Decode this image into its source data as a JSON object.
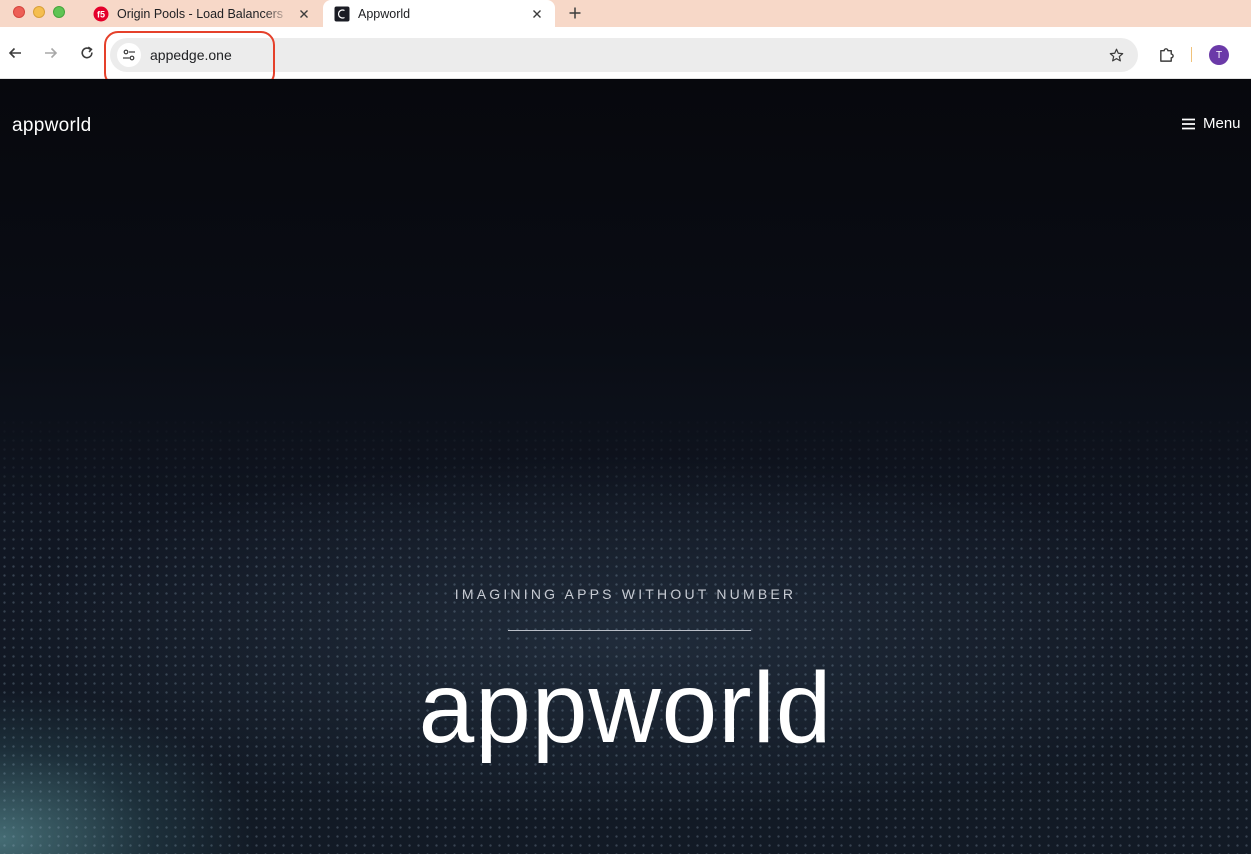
{
  "browser": {
    "tabs": [
      {
        "title": "Origin Pools - Load Balancers",
        "favicon": "f5-logo-icon",
        "active": false
      },
      {
        "title": "Appworld",
        "favicon": "appworld-favicon-icon",
        "active": true
      }
    ],
    "address_bar": {
      "url": "appedge.one"
    },
    "profile": {
      "initial": "T",
      "color": "#6b3aa8"
    },
    "tab_strip_color": "#f7d8c8"
  },
  "site": {
    "brand": "appworld",
    "menu_label": "Menu",
    "hero": {
      "tagline": "IMAGINING APPS WITHOUT NUMBER",
      "title": "appworld"
    }
  },
  "annotations": {
    "color": "#e5402a"
  }
}
